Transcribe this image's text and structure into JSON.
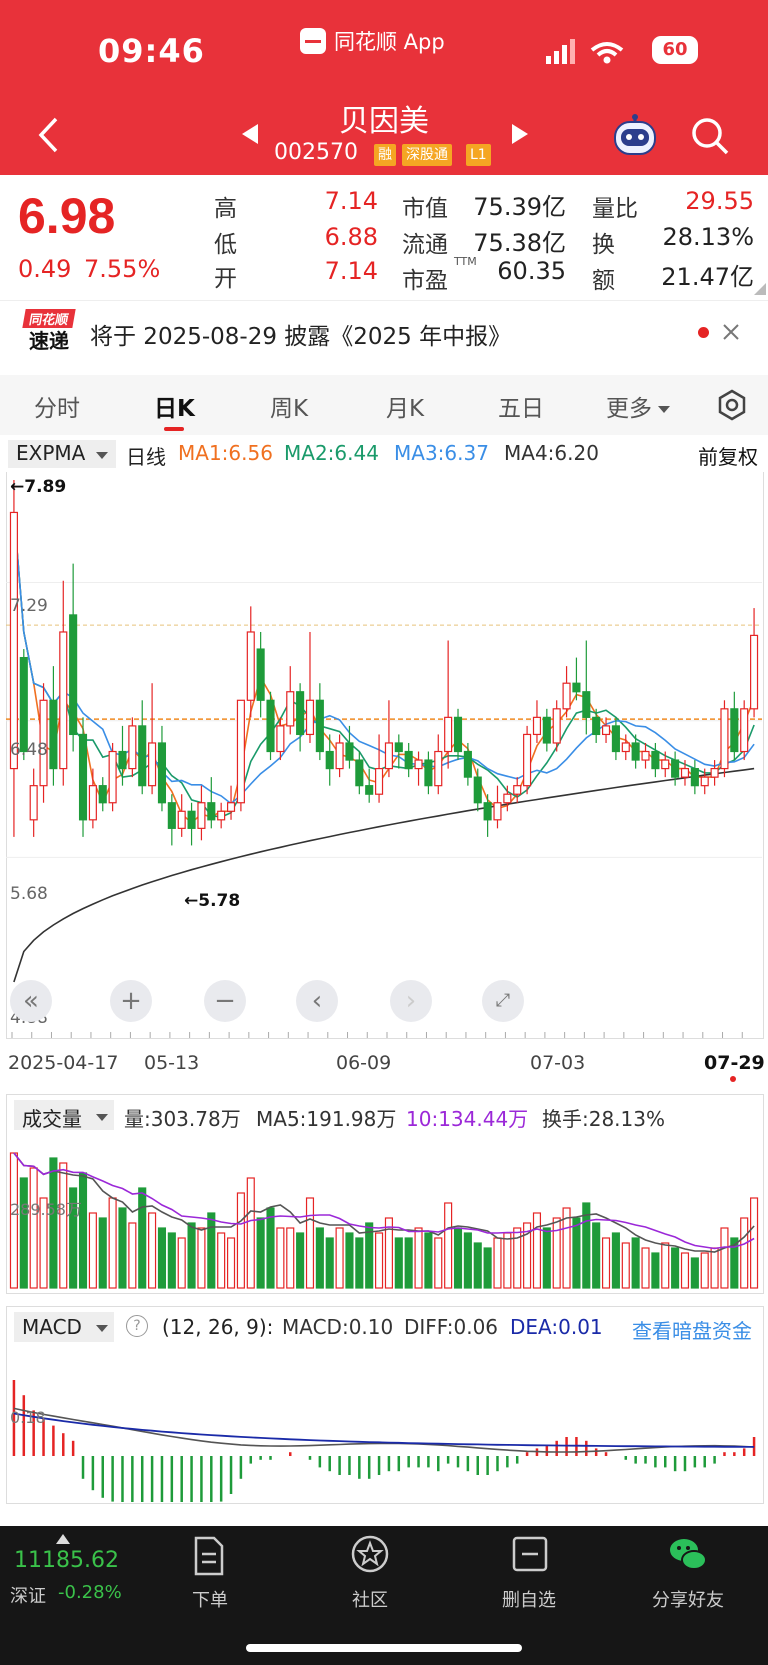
{
  "status_bar": {
    "time": "09:46",
    "app_name": "同花顺 App",
    "battery": "60"
  },
  "header": {
    "stock_name": "贝因美",
    "stock_code": "002570",
    "tags": [
      "融",
      "深股通",
      "L1"
    ]
  },
  "quote": {
    "price": "6.98",
    "change": "0.49",
    "change_pct": "7.55%",
    "high_label": "高",
    "high": "7.14",
    "low_label": "低",
    "low": "6.88",
    "open_label": "开",
    "open": "7.14",
    "mktcap_label": "市值",
    "mktcap": "75.39亿",
    "float_label": "流通",
    "float": "75.38亿",
    "pe_label": "市盈",
    "pe_sup": "TTM",
    "pe": "60.35",
    "volratio_label": "量比",
    "volratio": "29.55",
    "turnover_label": "换",
    "turnover": "28.13%",
    "amount_label": "额",
    "amount": "21.47亿"
  },
  "notice": {
    "logo_top": "同花顺",
    "logo_bottom": "速递",
    "text": "将于 2025-08-29 披露《2025 年中报》"
  },
  "tabs": [
    "分时",
    "日K",
    "周K",
    "月K",
    "五日",
    "更多"
  ],
  "ma_bar": {
    "indicator": "EXPMA",
    "period": "日线",
    "ma1": "MA1:6.56",
    "ma2": "MA2:6.44",
    "ma3": "MA3:6.37",
    "ma4": "MA4:6.20",
    "adjust": "前复权"
  },
  "price_chart": {
    "y_labels": [
      "7.29",
      "6.48",
      "5.68",
      "4.88"
    ],
    "high_mark": "←7.89",
    "low_mark": "←5.78",
    "dates": [
      "2025-04-17",
      "05-13",
      "06-09",
      "07-03",
      "07-29"
    ],
    "colors": {
      "up": "#e52424",
      "down": "#1e9b3a",
      "ma1": "#f07020",
      "ma2": "#1a9a6a",
      "ma3": "#3a8ee6",
      "ma4": "#333333"
    }
  },
  "chart_data": {
    "type": "candlestick",
    "ylim": [
      4.88,
      7.89
    ],
    "candles": [
      [
        6.2,
        7.7,
        5.8,
        7.89
      ],
      [
        6.85,
        6.3,
        6.25,
        6.9
      ],
      [
        5.9,
        6.1,
        5.8,
        6.2
      ],
      [
        6.1,
        6.6,
        6.0,
        6.7
      ],
      [
        6.6,
        6.2,
        6.1,
        6.8
      ],
      [
        6.2,
        7.0,
        6.1,
        7.3
      ],
      [
        7.1,
        6.4,
        6.3,
        7.4
      ],
      [
        6.4,
        5.9,
        5.8,
        6.5
      ],
      [
        5.9,
        6.1,
        5.85,
        6.2
      ],
      [
        6.1,
        6.0,
        5.95,
        6.15
      ],
      [
        6.0,
        6.3,
        5.95,
        6.35
      ],
      [
        6.3,
        6.2,
        6.1,
        6.45
      ],
      [
        6.2,
        6.45,
        6.15,
        6.5
      ],
      [
        6.45,
        6.1,
        6.05,
        6.6
      ],
      [
        6.1,
        6.35,
        6.05,
        6.7
      ],
      [
        6.35,
        6.0,
        5.95,
        6.45
      ],
      [
        6.0,
        5.85,
        5.75,
        6.05
      ],
      [
        5.85,
        5.95,
        5.8,
        6.05
      ],
      [
        5.95,
        5.85,
        5.75,
        6.0
      ],
      [
        5.85,
        6.0,
        5.78,
        6.1
      ],
      [
        6.0,
        5.9,
        5.85,
        6.15
      ],
      [
        5.9,
        5.95,
        5.85,
        6.0
      ],
      [
        5.95,
        6.0,
        5.9,
        6.1
      ],
      [
        6.0,
        6.6,
        5.95,
        6.6
      ],
      [
        6.6,
        7.0,
        6.5,
        7.15
      ],
      [
        6.9,
        6.6,
        6.5,
        7.0
      ],
      [
        6.6,
        6.3,
        6.25,
        6.65
      ],
      [
        6.3,
        6.45,
        6.25,
        6.5
      ],
      [
        6.45,
        6.65,
        6.4,
        6.8
      ],
      [
        6.65,
        6.4,
        6.3,
        6.7
      ],
      [
        6.4,
        6.6,
        6.35,
        7.0
      ],
      [
        6.6,
        6.3,
        6.25,
        6.7
      ],
      [
        6.3,
        6.2,
        6.1,
        6.4
      ],
      [
        6.2,
        6.35,
        6.15,
        6.4
      ],
      [
        6.35,
        6.25,
        6.2,
        6.45
      ],
      [
        6.25,
        6.1,
        6.05,
        6.3
      ],
      [
        6.1,
        6.05,
        6.0,
        6.2
      ],
      [
        6.05,
        6.2,
        6.0,
        6.4
      ],
      [
        6.2,
        6.35,
        6.15,
        6.6
      ],
      [
        6.35,
        6.3,
        6.2,
        6.4
      ],
      [
        6.3,
        6.2,
        6.15,
        6.35
      ],
      [
        6.2,
        6.25,
        6.1,
        6.3
      ],
      [
        6.25,
        6.1,
        6.05,
        6.3
      ],
      [
        6.1,
        6.3,
        6.05,
        6.4
      ],
      [
        6.3,
        6.5,
        6.2,
        6.95
      ],
      [
        6.5,
        6.3,
        6.25,
        6.55
      ],
      [
        6.3,
        6.15,
        6.1,
        6.35
      ],
      [
        6.15,
        6.0,
        5.95,
        6.2
      ],
      [
        6.0,
        5.9,
        5.8,
        6.05
      ],
      [
        5.9,
        6.0,
        5.85,
        6.1
      ],
      [
        6.0,
        6.05,
        5.95,
        6.1
      ],
      [
        6.05,
        6.1,
        6.0,
        6.15
      ],
      [
        6.1,
        6.4,
        6.05,
        6.45
      ],
      [
        6.4,
        6.5,
        6.35,
        6.6
      ],
      [
        6.5,
        6.35,
        6.3,
        6.55
      ],
      [
        6.35,
        6.55,
        6.3,
        6.6
      ],
      [
        6.55,
        6.7,
        6.5,
        6.8
      ],
      [
        6.7,
        6.65,
        6.6,
        6.85
      ],
      [
        6.65,
        6.5,
        6.4,
        6.95
      ],
      [
        6.5,
        6.4,
        6.35,
        6.55
      ],
      [
        6.4,
        6.45,
        6.35,
        6.5
      ],
      [
        6.45,
        6.3,
        6.25,
        6.5
      ],
      [
        6.3,
        6.35,
        6.25,
        6.4
      ],
      [
        6.35,
        6.25,
        6.2,
        6.4
      ],
      [
        6.25,
        6.3,
        6.2,
        6.35
      ],
      [
        6.3,
        6.2,
        6.15,
        6.35
      ],
      [
        6.2,
        6.25,
        6.15,
        6.3
      ],
      [
        6.25,
        6.15,
        6.1,
        6.3
      ],
      [
        6.15,
        6.2,
        6.1,
        6.25
      ],
      [
        6.2,
        6.1,
        6.05,
        6.25
      ],
      [
        6.1,
        6.15,
        6.05,
        6.2
      ],
      [
        6.15,
        6.2,
        6.1,
        6.25
      ],
      [
        6.2,
        6.55,
        6.15,
        6.6
      ],
      [
        6.55,
        6.3,
        6.25,
        6.65
      ],
      [
        6.3,
        6.55,
        6.25,
        6.6
      ],
      [
        6.55,
        6.98,
        6.5,
        7.14
      ]
    ]
  },
  "volume": {
    "indicator": "成交量",
    "vol": "量:303.78万",
    "ma5": "MA5:191.98万",
    "ma10": "10:134.44万",
    "turnover": "换手:28.13%",
    "y_label": "289.58万"
  },
  "volume_data": [
    270,
    220,
    240,
    180,
    260,
    250,
    200,
    230,
    150,
    140,
    180,
    160,
    130,
    200,
    150,
    120,
    110,
    100,
    130,
    120,
    150,
    110,
    100,
    190,
    220,
    140,
    160,
    120,
    120,
    110,
    180,
    120,
    100,
    120,
    110,
    100,
    130,
    110,
    140,
    100,
    100,
    120,
    110,
    100,
    170,
    120,
    110,
    90,
    80,
    100,
    110,
    120,
    130,
    150,
    120,
    140,
    160,
    140,
    170,
    130,
    100,
    110,
    90,
    100,
    80,
    70,
    90,
    80,
    70,
    60,
    70,
    80,
    120,
    100,
    140,
    180
  ],
  "macd": {
    "indicator": "MACD",
    "params": "(12, 26, 9):",
    "macd_val": "MACD:0.10",
    "diff": "DIFF:0.06",
    "dea": "DEA:0.01",
    "link": "查看暗盘资金",
    "y_label": "0.18"
  },
  "macd_data": [
    0.2,
    0.16,
    0.12,
    0.1,
    0.08,
    0.06,
    0.04,
    -0.06,
    -0.09,
    -0.11,
    -0.12,
    -0.13,
    -0.13,
    -0.14,
    -0.14,
    -0.13,
    -0.14,
    -0.15,
    -0.15,
    -0.14,
    -0.13,
    -0.12,
    -0.1,
    -0.06,
    -0.02,
    -0.01,
    -0.01,
    0.0,
    0.01,
    0.0,
    -0.01,
    -0.03,
    -0.04,
    -0.05,
    -0.05,
    -0.06,
    -0.06,
    -0.05,
    -0.04,
    -0.04,
    -0.03,
    -0.03,
    -0.03,
    -0.04,
    -0.02,
    -0.03,
    -0.04,
    -0.05,
    -0.05,
    -0.04,
    -0.03,
    -0.02,
    0.01,
    0.02,
    0.03,
    0.04,
    0.05,
    0.05,
    0.04,
    0.02,
    0.01,
    0.0,
    -0.01,
    -0.02,
    -0.02,
    -0.03,
    -0.03,
    -0.04,
    -0.04,
    -0.03,
    -0.03,
    -0.02,
    0.01,
    0.01,
    0.02,
    0.05
  ],
  "bottom_bar": {
    "index_value": "11185.62",
    "index_name": "深证",
    "index_change": "-0.28%",
    "items": [
      "下单",
      "社区",
      "删自选",
      "分享好友"
    ]
  }
}
